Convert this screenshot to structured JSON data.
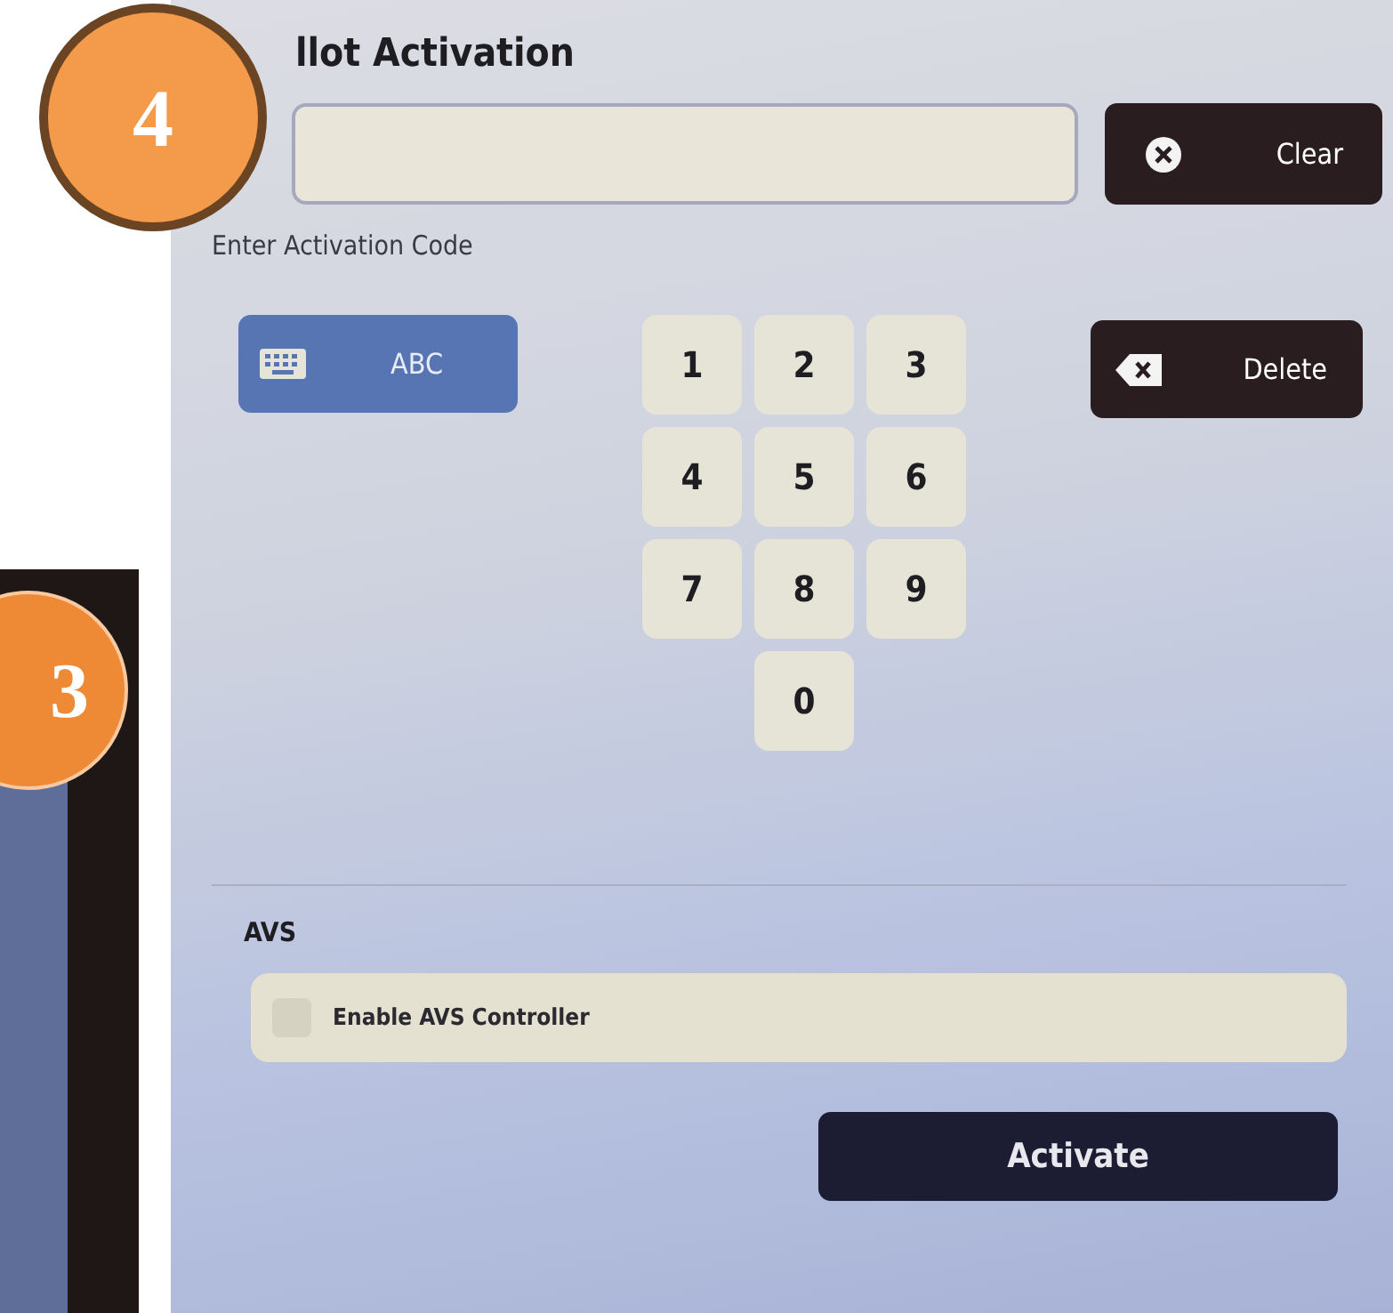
{
  "badges": [
    {
      "label": "4"
    },
    {
      "label": "3"
    }
  ],
  "title": "llot Activation",
  "clear_button": "Clear",
  "code_label": "Enter Activation Code",
  "abc_button": "ABC",
  "keypad": [
    "1",
    "2",
    "3",
    "4",
    "5",
    "6",
    "7",
    "8",
    "9",
    "0"
  ],
  "delete_button": "Delete",
  "section_title": "AVS",
  "avs_checkbox": {
    "label": "Enable AVS Controller",
    "checked": false
  },
  "activate_button": "Activate"
}
